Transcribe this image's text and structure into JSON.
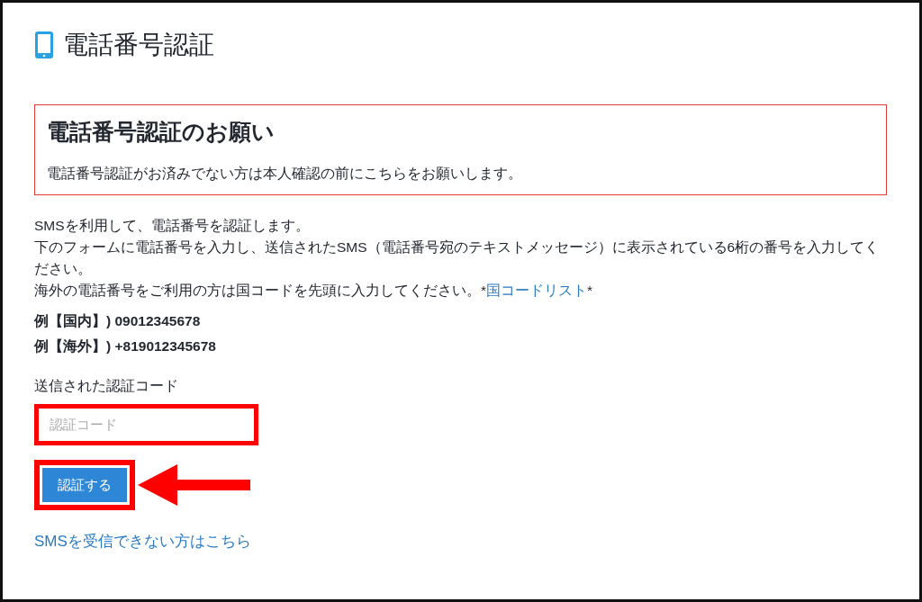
{
  "page_title": "電話番号認証",
  "alert": {
    "heading": "電話番号認証のお願い",
    "text": "電話番号認証がお済みでない方は本人確認の前にこちらをお願いします。"
  },
  "instructions": [
    "SMSを利用して、電話番号を認証します。",
    "下のフォームに電話番号を入力し、送信されたSMS（電話番号宛のテキストメッセージ）に表示されている6桁の番号を入力してください。"
  ],
  "country_note": {
    "text": "海外の電話番号をご利用の方は国コードを先頭に入力してください。*",
    "link": "国コードリスト",
    "suffix": "*"
  },
  "examples": [
    "例【国内】) 09012345678",
    "例【海外】) +819012345678"
  ],
  "code_field": {
    "label": "送信された認証コード",
    "placeholder": "認証コード",
    "highlighted": true
  },
  "submit_button": {
    "label": "認証する",
    "highlighted": true,
    "arrow": true
  },
  "help_link": "SMSを受信できない方はこちら"
}
